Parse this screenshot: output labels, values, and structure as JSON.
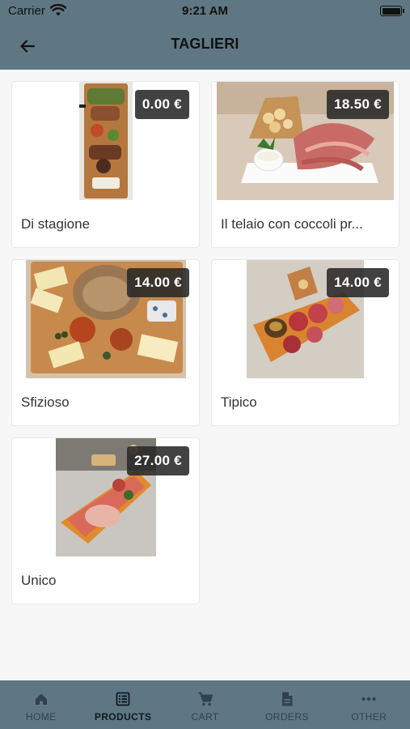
{
  "status": {
    "carrier": "Carrier",
    "time": "9:21 AM"
  },
  "header": {
    "title": "TAGLIERI"
  },
  "products": [
    {
      "name": "Di stagione",
      "price": "0.00 €"
    },
    {
      "name": "Il telaio con coccoli pr...",
      "price": "18.50 €"
    },
    {
      "name": "Sfizioso",
      "price": "14.00 €"
    },
    {
      "name": "Tipico",
      "price": "14.00 €"
    },
    {
      "name": "Unico",
      "price": "27.00 €"
    }
  ],
  "tabs": [
    {
      "label": "HOME",
      "icon": "home-icon"
    },
    {
      "label": "PRODUCTS",
      "icon": "list-icon"
    },
    {
      "label": "CART",
      "icon": "cart-icon"
    },
    {
      "label": "ORDERS",
      "icon": "document-icon"
    },
    {
      "label": "OTHER",
      "icon": "more-icon"
    }
  ],
  "active_tab": "PRODUCTS",
  "colors": {
    "bar": "#5f7782",
    "badge": "#282828",
    "active_tab": "#0d1a22"
  }
}
